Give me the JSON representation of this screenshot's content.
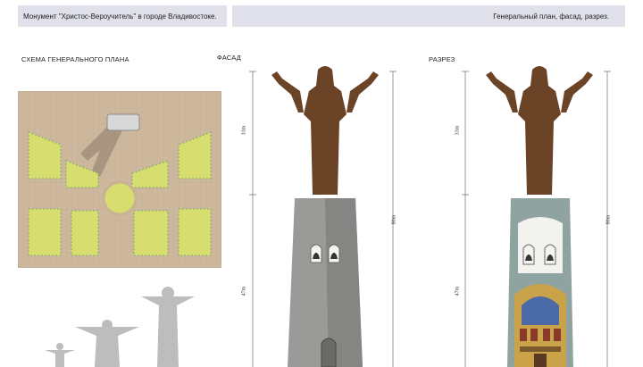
{
  "header": {
    "left_title": "Монумент \"Христос-Вероучитель\" в городе Владивостоке.",
    "right_title": "Генеральный план, фасад, разрез."
  },
  "sections": {
    "plan_label": "СХЕМА ГЕНЕРАЛЬНОГО ПЛАНА",
    "facade_label": "ФАСАД",
    "section_label": "РАЗРЕЗ"
  },
  "dimensions": {
    "statue_height": "33m",
    "pedestal_height": "47m",
    "total_height": "80m"
  },
  "colors": {
    "header_bg": "#dfe0ea",
    "plaza": "#c8b49a",
    "lawn": "#d6dc6a",
    "bronze": "#6b4327",
    "stone": "#9a9a98",
    "section_wall": "#8fa3a0"
  }
}
